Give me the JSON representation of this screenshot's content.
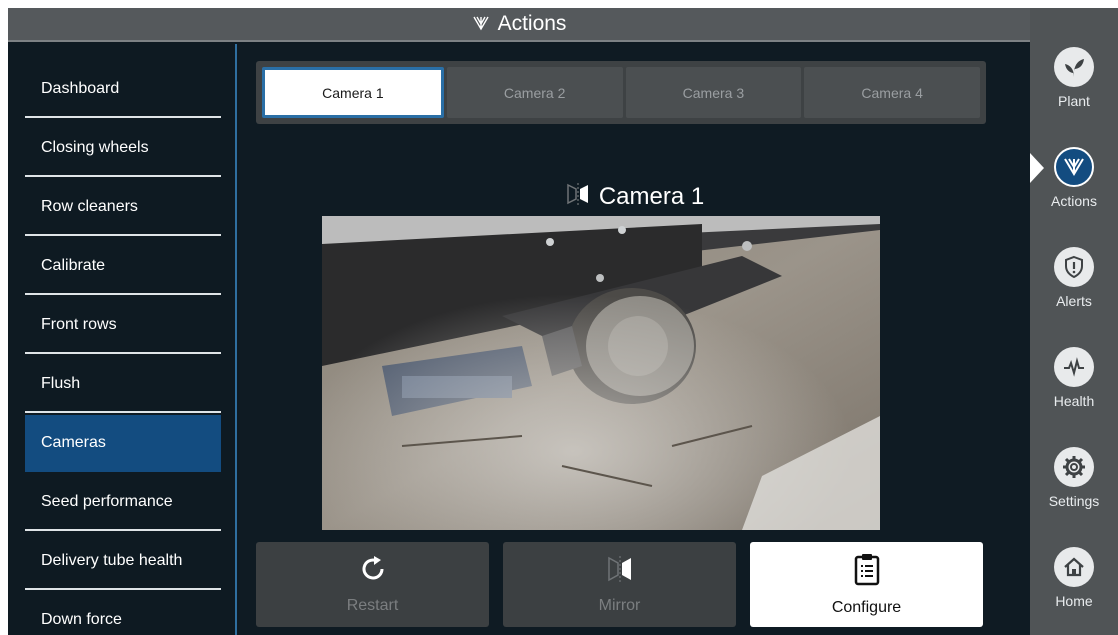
{
  "header": {
    "title": "Actions",
    "icon": "planter-icon"
  },
  "sidebar": {
    "items": [
      {
        "label": "Dashboard",
        "active": false
      },
      {
        "label": "Closing wheels",
        "active": false
      },
      {
        "label": "Row cleaners",
        "active": false
      },
      {
        "label": "Calibrate",
        "active": false
      },
      {
        "label": "Front rows",
        "active": false
      },
      {
        "label": "Flush",
        "active": false
      },
      {
        "label": "Cameras",
        "active": true
      },
      {
        "label": "Seed performance",
        "active": false
      },
      {
        "label": "Delivery tube health",
        "active": false
      },
      {
        "label": "Down force",
        "active": false
      }
    ]
  },
  "tabs": [
    {
      "label": "Camera 1",
      "active": true
    },
    {
      "label": "Camera 2",
      "active": false
    },
    {
      "label": "Camera 3",
      "active": false
    },
    {
      "label": "Camera 4",
      "active": false
    }
  ],
  "camera_view": {
    "title": "Camera 1",
    "title_icon": "mirror-icon"
  },
  "actions": {
    "restart": {
      "label": "Restart",
      "icon": "restart-icon"
    },
    "mirror": {
      "label": "Mirror",
      "icon": "mirror-icon"
    },
    "configure": {
      "label": "Configure",
      "icon": "clipboard-icon"
    }
  },
  "rail": {
    "items": [
      {
        "label": "Plant",
        "icon": "plant-icon"
      },
      {
        "label": "Actions",
        "icon": "planter-icon",
        "active": true
      },
      {
        "label": "Alerts",
        "icon": "shield-alert-icon"
      },
      {
        "label": "Health",
        "icon": "heartbeat-icon"
      },
      {
        "label": "Settings",
        "icon": "gear-icon"
      },
      {
        "label": "Home",
        "icon": "home-icon"
      }
    ]
  },
  "colors": {
    "accent": "#134c80",
    "background": "#0e1a22",
    "rail": "#505456",
    "header": "#55595c"
  }
}
